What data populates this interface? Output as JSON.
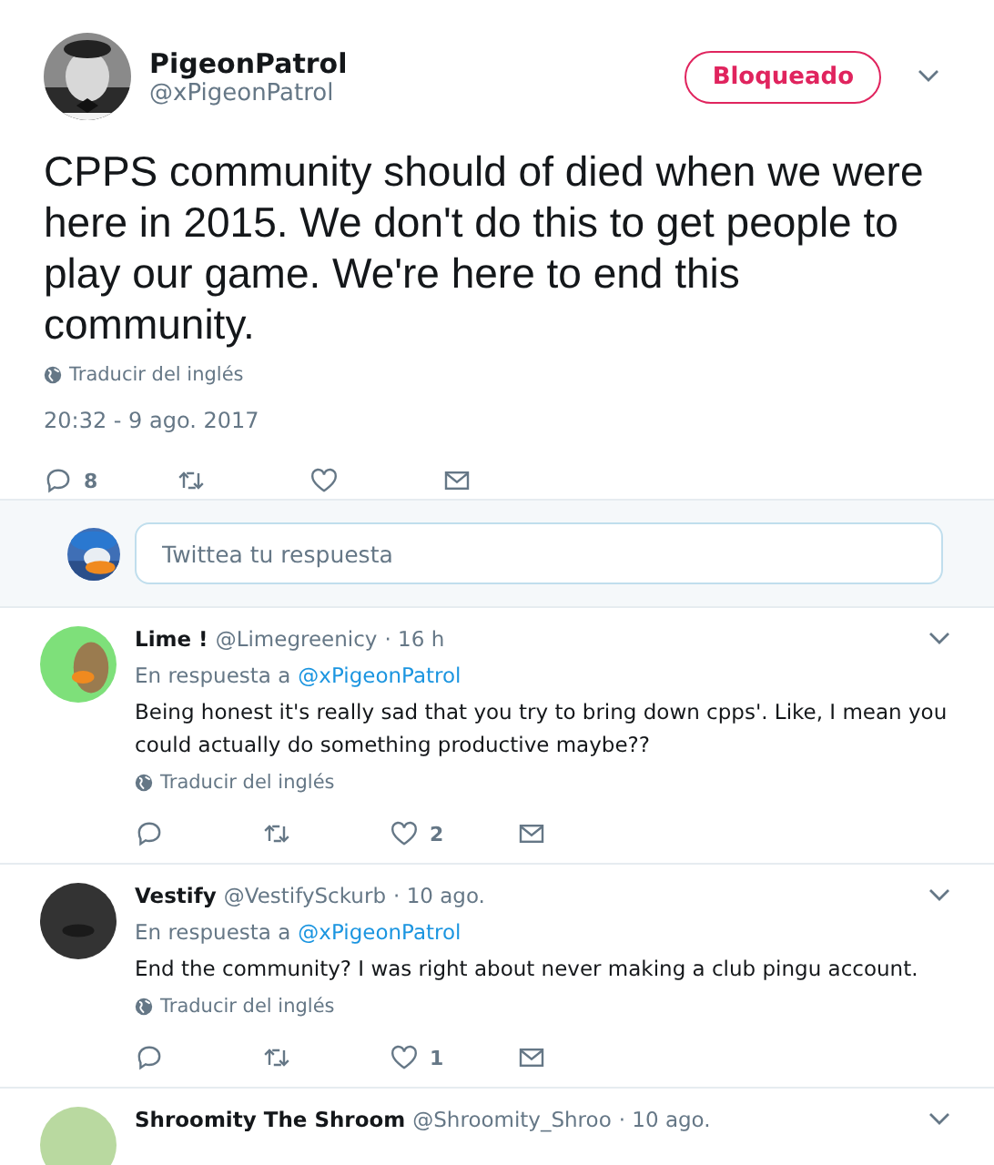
{
  "tweet": {
    "name": "PigeonPatrol",
    "handle": "@xPigeonPatrol",
    "blocked_button": "Bloqueado",
    "text": "CPPS community should of died when we were here in 2015. We don't do this to get people to play our game. We're here to end this community.",
    "translate": "Traducir del inglés",
    "timestamp": "20:32 - 9 ago. 2017",
    "actions": [
      {
        "kind": "reply",
        "count": "8"
      },
      {
        "kind": "retweet"
      },
      {
        "kind": "like"
      },
      {
        "kind": "message"
      }
    ]
  },
  "reply_box": {
    "placeholder": "Twittea tu respuesta"
  },
  "replies": [
    {
      "name": "Lime !",
      "handle": "@Limegreenicy",
      "time": "· 16 h",
      "reply_to_label": "En respuesta a",
      "mention": "@xPigeonPatrol",
      "text": "Being honest it's really sad that you try to bring down cpps'. Like, I mean you could actually do something productive maybe??",
      "translate": "Traducir del inglés",
      "actions": [
        {
          "kind": "reply"
        },
        {
          "kind": "retweet"
        },
        {
          "kind": "like",
          "count": "2"
        },
        {
          "kind": "message"
        }
      ]
    },
    {
      "name": "Vestify",
      "handle": "@VestifySckurb",
      "time": "· 10 ago.",
      "reply_to_label": "En respuesta a",
      "mention": "@xPigeonPatrol",
      "text": "End the community? I was right about never making a club pingu account.",
      "translate": "Traducir del inglés",
      "actions": [
        {
          "kind": "reply"
        },
        {
          "kind": "retweet"
        },
        {
          "kind": "like",
          "count": "1"
        },
        {
          "kind": "message"
        }
      ]
    },
    {
      "name": "Shroomity The Shroom",
      "handle": "@Shroomity_Shroo",
      "time": "· 10 ago."
    }
  ]
}
